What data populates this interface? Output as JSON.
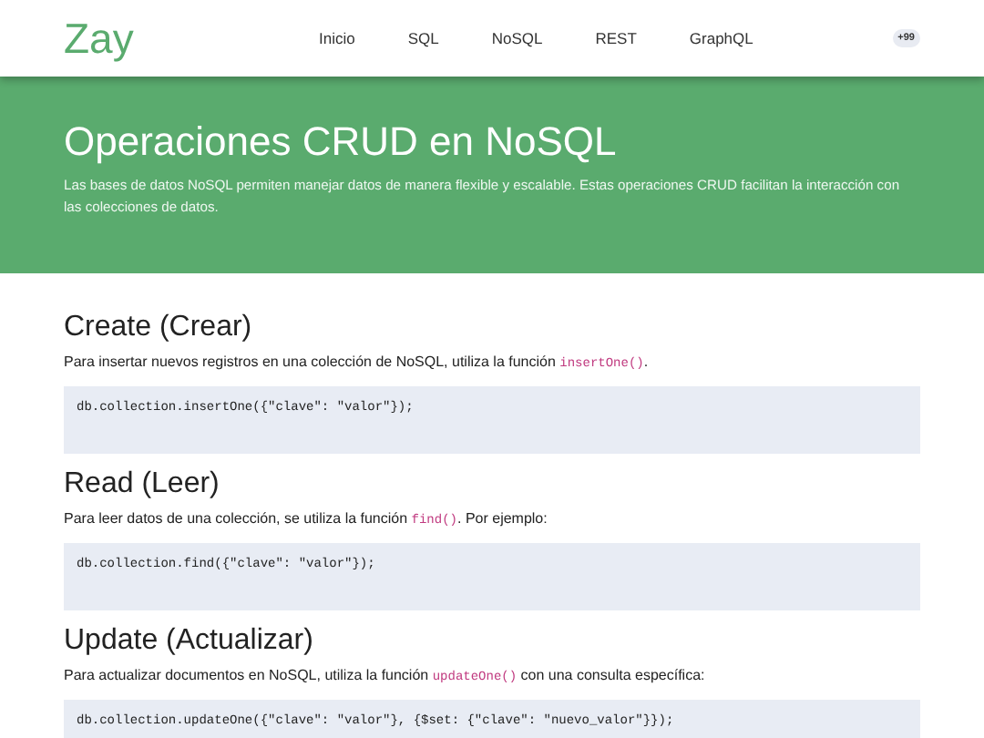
{
  "header": {
    "logo": "Zay",
    "nav": [
      {
        "label": "Inicio"
      },
      {
        "label": "SQL"
      },
      {
        "label": "NoSQL"
      },
      {
        "label": "REST"
      },
      {
        "label": "GraphQL"
      }
    ],
    "badge": "+99"
  },
  "hero": {
    "title": "Operaciones CRUD en NoSQL",
    "text": "Las bases de datos NoSQL permiten manejar datos de manera flexible y escalable. Estas operaciones CRUD facilitan la interacción con las colecciones de datos."
  },
  "sections": [
    {
      "heading": "Create (Crear)",
      "text_before": "Para insertar nuevos registros en una colección de NoSQL, utiliza la función ",
      "inline_code": "insertOne()",
      "text_after": ".",
      "code": "db.collection.insertOne({\"clave\": \"valor\"});"
    },
    {
      "heading": "Read (Leer)",
      "text_before": "Para leer datos de una colección, se utiliza la función ",
      "inline_code": "find()",
      "text_after": ". Por ejemplo:",
      "code": "db.collection.find({\"clave\": \"valor\"});"
    },
    {
      "heading": "Update (Actualizar)",
      "text_before": "Para actualizar documentos en NoSQL, utiliza la función ",
      "inline_code": "updateOne()",
      "text_after": " con una consulta específica:",
      "code": "db.collection.updateOne({\"clave\": \"valor\"}, {$set: {\"clave\": \"nuevo_valor\"}});"
    }
  ]
}
